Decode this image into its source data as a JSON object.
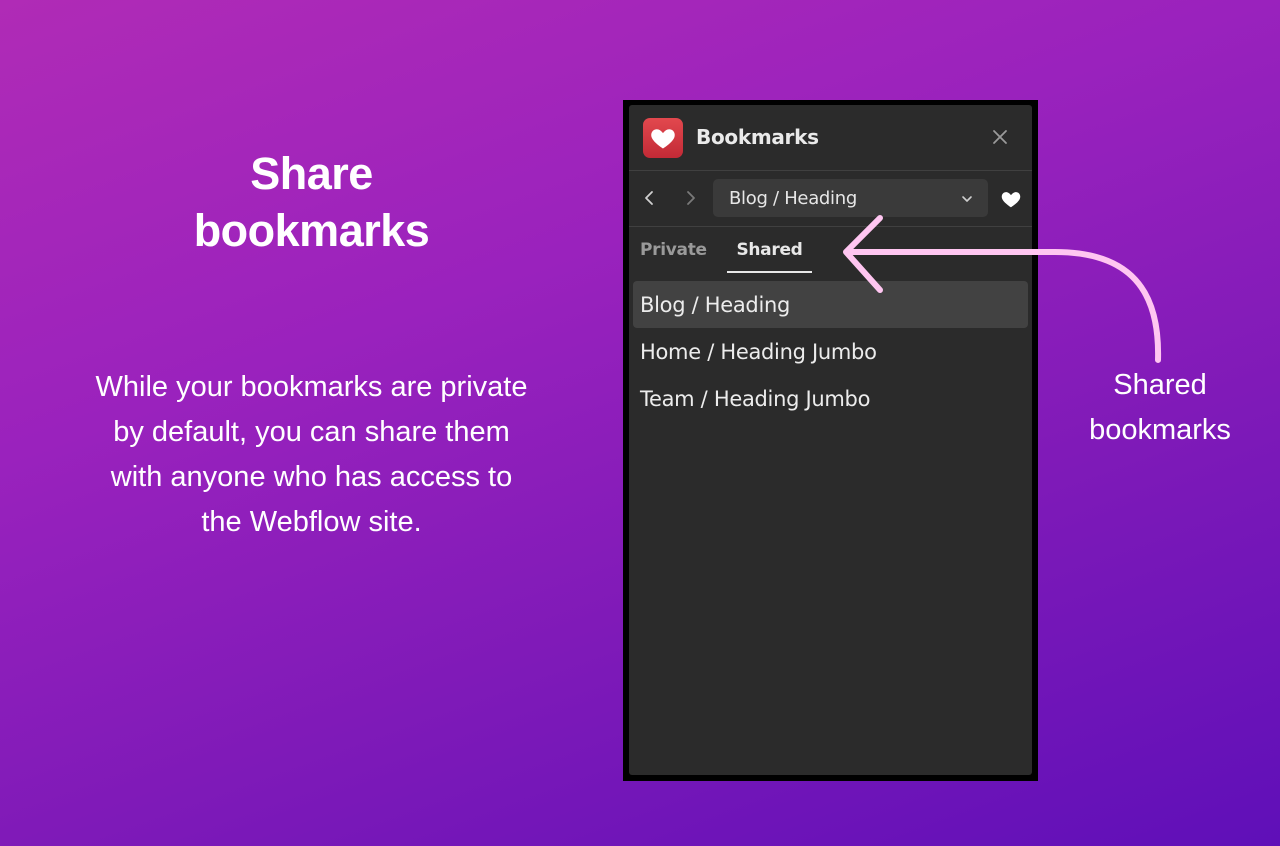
{
  "promo": {
    "title_line1": "Share",
    "title_line2": "bookmarks",
    "desc_lines": [
      "While your bookmarks are private",
      "by default, you can share them",
      "with anyone who has access to",
      "the Webflow site."
    ]
  },
  "panel": {
    "title": "Bookmarks",
    "logo_icon": "heart-icon",
    "close_icon": "close-icon",
    "nav": {
      "back_icon": "chevron-left-icon",
      "forward_icon": "chevron-right-icon",
      "selected_page": "Blog / Heading",
      "dropdown_icon": "chevron-down-icon",
      "bookmark_icon": "heart-icon"
    },
    "tabs": [
      {
        "label": "Private",
        "active": false
      },
      {
        "label": "Shared",
        "active": true
      }
    ],
    "items": [
      {
        "label": "Blog / Heading",
        "active": true
      },
      {
        "label": "Home / Heading Jumbo",
        "active": false
      },
      {
        "label": "Team / Heading Jumbo",
        "active": false
      }
    ]
  },
  "callout": {
    "line1": "Shared",
    "line2": "bookmarks",
    "arrow_color": "#ffc6f1"
  },
  "colors": {
    "background_start": "#b02bb6",
    "background_end": "#5f0fb8",
    "panel_bg": "#2b2b2b",
    "logo_red": "#d63a43"
  }
}
